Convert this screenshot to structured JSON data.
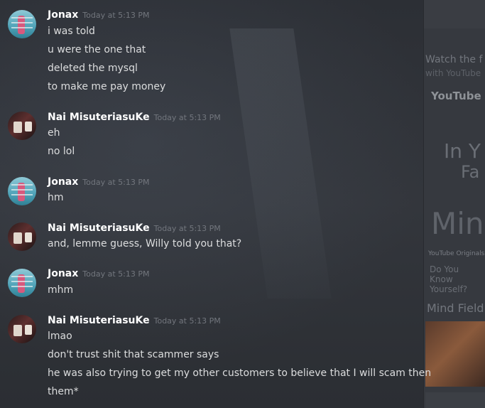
{
  "sidebar": {
    "line1": "Watch the f",
    "line2": "with YouTube",
    "brand": "YouTube Ori",
    "promo1": "In Y",
    "promo2": "Fa",
    "promo3": "Mind",
    "promo4": "YouTube Originals",
    "promo5": "Do You Know Yourself?",
    "promo6": "Mind Field"
  },
  "messages": [
    {
      "author": "Jonax",
      "timestamp": "Today at 5:13 PM",
      "lines": [
        "i was told",
        "u were the one that",
        "deleted the mysql",
        "to make me pay money"
      ]
    },
    {
      "author": "Nai MisuteriasuKe",
      "timestamp": "Today at 5:13 PM",
      "lines": [
        "eh",
        "no lol"
      ]
    },
    {
      "author": "Jonax",
      "timestamp": "Today at 5:13 PM",
      "lines": [
        "hm"
      ]
    },
    {
      "author": "Nai MisuteriasuKe",
      "timestamp": "Today at 5:13 PM",
      "lines": [
        "and, lemme guess, Willy told you that?"
      ]
    },
    {
      "author": "Jonax",
      "timestamp": "Today at 5:13 PM",
      "lines": [
        "mhm"
      ]
    },
    {
      "author": "Nai MisuteriasuKe",
      "timestamp": "Today at 5:13 PM",
      "lines": [
        "lmao",
        "don't trust shit that scammer says",
        "he was also trying to get my other customers to believe that I will scam then",
        "them*"
      ]
    }
  ]
}
